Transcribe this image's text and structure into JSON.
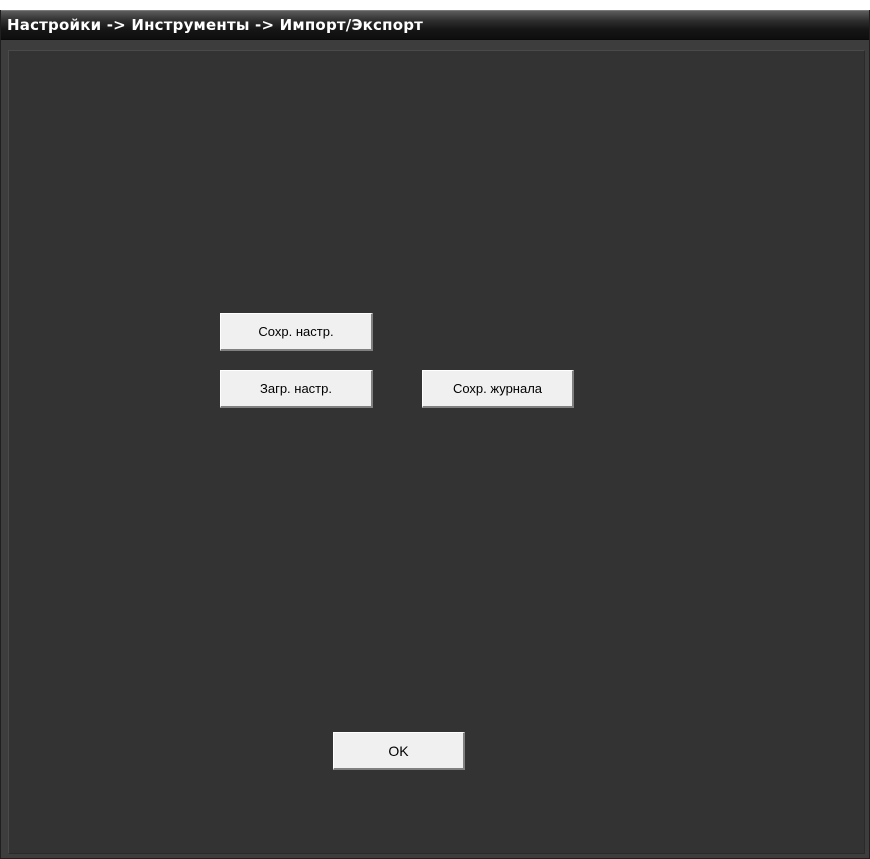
{
  "window": {
    "title": "Настройки -> Инструменты -> Импорт/Экспорт"
  },
  "buttons": {
    "save_settings": "Сохр. настр.",
    "load_settings": "Загр. настр.",
    "save_log": "Сохр. журнала",
    "ok": "OK"
  },
  "colors": {
    "background": "#333333",
    "titlebar": "#161616",
    "button_face": "#f0f0f0"
  }
}
